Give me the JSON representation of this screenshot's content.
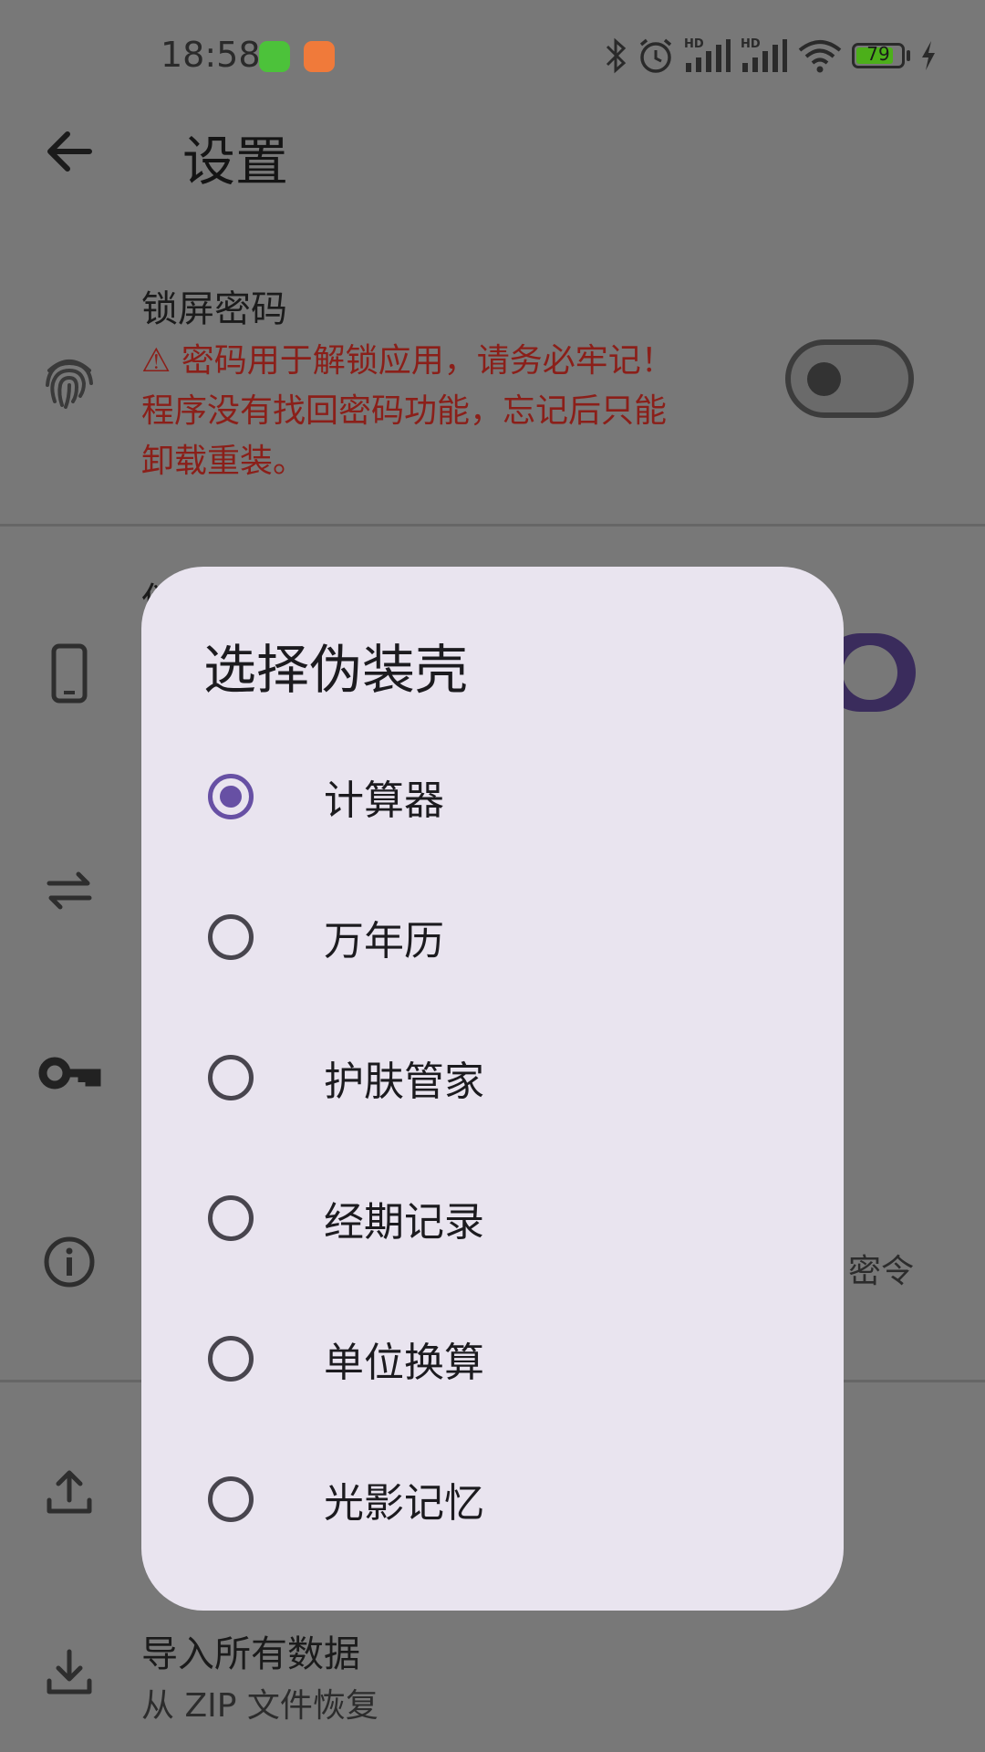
{
  "status_bar": {
    "time": "18:58",
    "battery_level": "79",
    "signal_tag_1": "HD",
    "signal_tag_2": "HD",
    "icons": [
      "bluetooth-icon",
      "alarm-icon",
      "signal-icon",
      "signal-icon",
      "wifi-icon",
      "battery-icon",
      "charging-icon"
    ]
  },
  "header": {
    "title": "设置"
  },
  "settings": {
    "lock_password": {
      "title": "锁屏密码",
      "warning_line1": "⚠ 密码用于解锁应用，请务必牢记！",
      "warning_line2": "程序没有找回密码功能，忘记后只能",
      "warning_line3": "卸载重装。",
      "enabled": false
    },
    "disguise_partial_title": "伪",
    "disguise_enabled": true,
    "info_partial_text": "密令",
    "import": {
      "title": "导入所有数据",
      "subtitle": "从 ZIP 文件恢复"
    }
  },
  "dialog": {
    "title": "选择伪装壳",
    "selected_index": 0,
    "options": [
      "计算器",
      "万年历",
      "护肤管家",
      "经期记录",
      "单位换算",
      "光影记忆"
    ]
  },
  "colors": {
    "accent": "#6750a4",
    "warning": "#8b1f19",
    "scrim": "#787878",
    "dialog_bg": "#e9e4ef"
  }
}
